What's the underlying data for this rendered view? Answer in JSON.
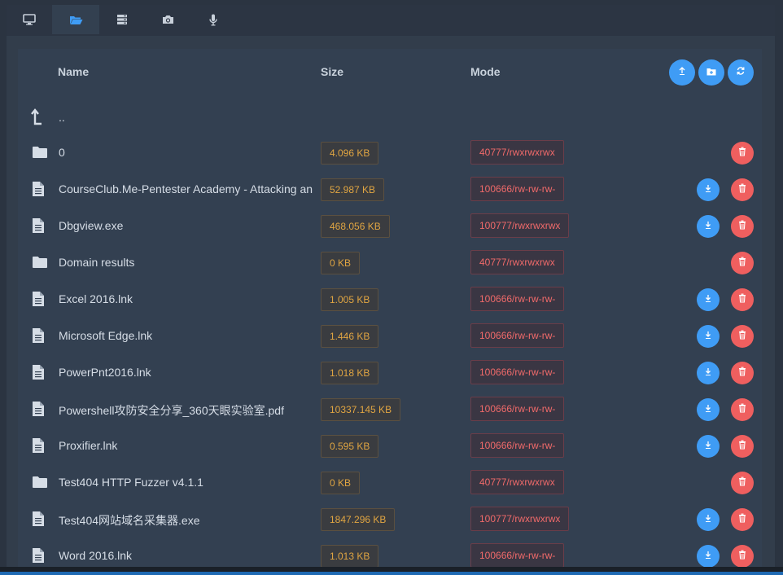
{
  "tabs": [
    {
      "icon": "monitor-icon"
    },
    {
      "icon": "folder-open-icon",
      "active": true
    },
    {
      "icon": "server-icon"
    },
    {
      "icon": "camera-icon"
    },
    {
      "icon": "microphone-icon"
    }
  ],
  "table": {
    "headers": {
      "name": "Name",
      "size": "Size",
      "mode": "Mode"
    },
    "actions": {
      "upload_icon": "upload-icon",
      "new_folder_icon": "folder-plus-icon",
      "refresh_icon": "refresh-icon"
    },
    "parent_label": "..",
    "rows": [
      {
        "name": "0",
        "type": "folder",
        "size": "4.096 KB",
        "mode": "40777/rwxrwxrwx",
        "download": false
      },
      {
        "name": "CourseClub.Me-Pentester Academy - Attacking and Defending Active Directory",
        "type": "file",
        "size": "52.987 KB",
        "mode": "100666/rw-rw-rw-",
        "download": true
      },
      {
        "name": "Dbgview.exe",
        "type": "file",
        "size": "468.056 KB",
        "mode": "100777/rwxrwxrwx",
        "download": true
      },
      {
        "name": "Domain results",
        "type": "folder",
        "size": "0 KB",
        "mode": "40777/rwxrwxrwx",
        "download": false
      },
      {
        "name": "Excel 2016.lnk",
        "type": "file",
        "size": "1.005 KB",
        "mode": "100666/rw-rw-rw-",
        "download": true
      },
      {
        "name": "Microsoft Edge.lnk",
        "type": "file",
        "size": "1.446 KB",
        "mode": "100666/rw-rw-rw-",
        "download": true
      },
      {
        "name": "PowerPnt2016.lnk",
        "type": "file",
        "size": "1.018 KB",
        "mode": "100666/rw-rw-rw-",
        "download": true
      },
      {
        "name": "Powershell攻防安全分享_360天眼实验室.pdf",
        "type": "file",
        "size": "10337.145 KB",
        "mode": "100666/rw-rw-rw-",
        "download": true
      },
      {
        "name": "Proxifier.lnk",
        "type": "file",
        "size": "0.595 KB",
        "mode": "100666/rw-rw-rw-",
        "download": true
      },
      {
        "name": "Test404 HTTP Fuzzer v4.1.1",
        "type": "folder",
        "size": "0 KB",
        "mode": "40777/rwxrwxrwx",
        "download": false
      },
      {
        "name": "Test404网站域名采集器.exe",
        "type": "file",
        "size": "1847.296 KB",
        "mode": "100777/rwxrwxrwx",
        "download": true
      },
      {
        "name": "Word 2016.lnk",
        "type": "file",
        "size": "1.013 KB",
        "mode": "100666/rw-rw-rw-",
        "download": true
      }
    ]
  },
  "colors": {
    "accent": "#3f9cf5",
    "danger": "#ef5f5f",
    "size_text": "#e0a542",
    "mode_text": "#f06a6a"
  }
}
